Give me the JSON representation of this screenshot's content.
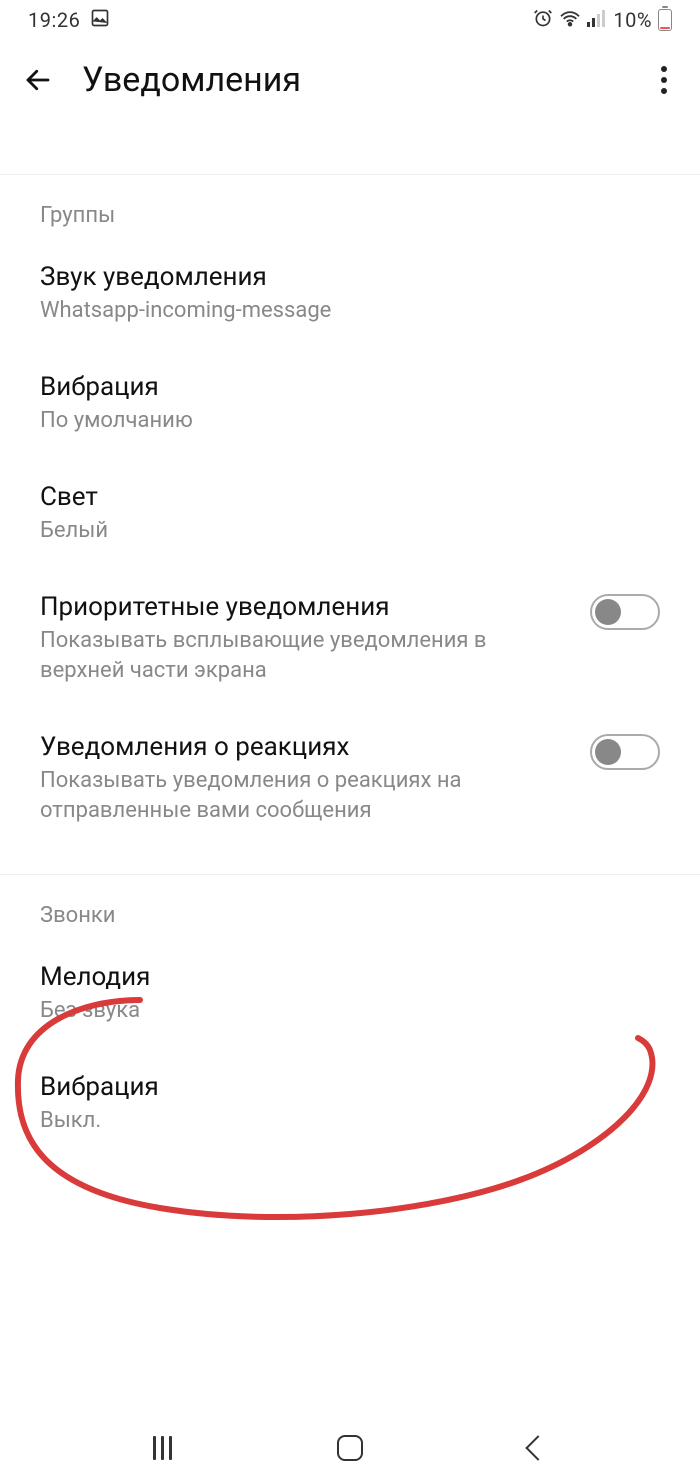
{
  "status": {
    "time": "19:26",
    "battery_text": "10%"
  },
  "appbar": {
    "title": "Уведомления"
  },
  "clipped_text": "на отправленные вами сообщения",
  "sections": {
    "groups": {
      "header": "Группы",
      "sound": {
        "title": "Звук уведомления",
        "sub": "Whatsapp-incoming-message"
      },
      "vibration": {
        "title": "Вибрация",
        "sub": "По умолчанию"
      },
      "light": {
        "title": "Свет",
        "sub": "Белый"
      },
      "priority": {
        "title": "Приоритетные уведомления",
        "sub": "Показывать всплывающие уведомления в верхней части экрана"
      },
      "reactions": {
        "title": "Уведомления о реакциях",
        "sub": "Показывать уведомления о реакциях на отправленные вами сообщения"
      }
    },
    "calls": {
      "header": "Звонки",
      "ringtone": {
        "title": "Мелодия",
        "sub": "Без звука"
      },
      "vibration": {
        "title": "Вибрация",
        "sub": "Выкл."
      }
    }
  },
  "colors": {
    "annotation": "#d93a3a"
  }
}
